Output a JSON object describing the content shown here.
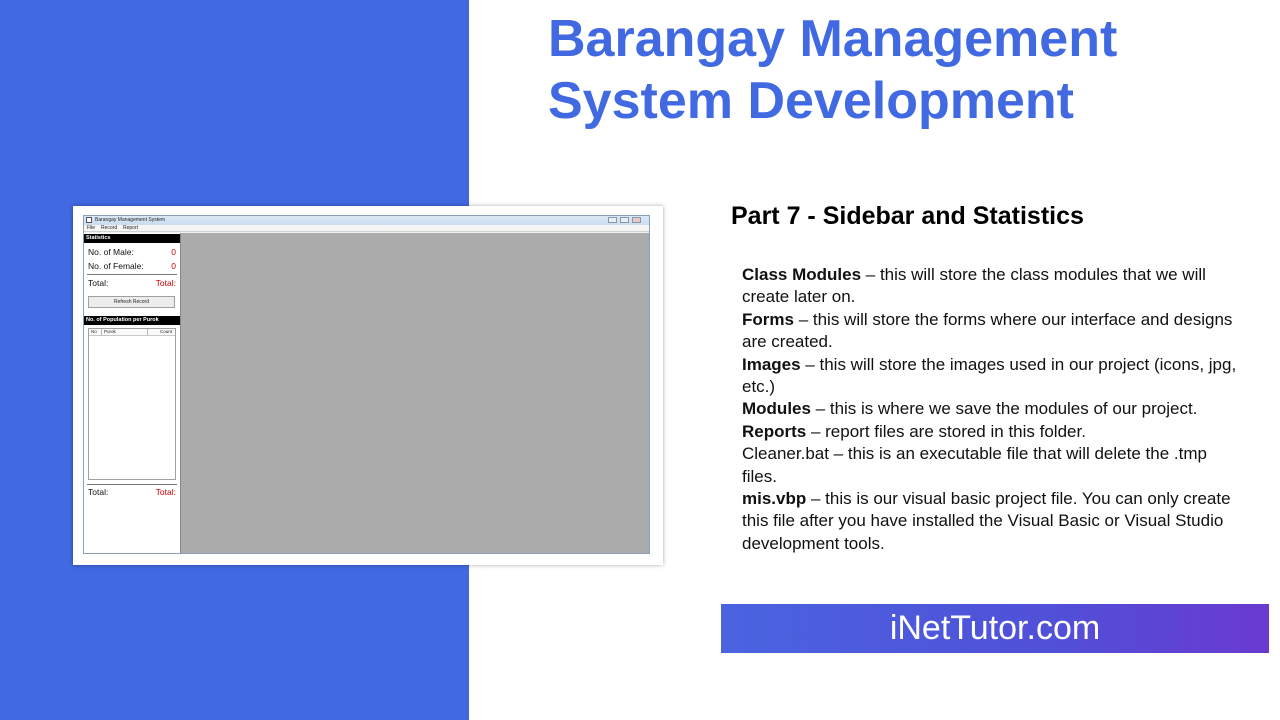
{
  "slide": {
    "title_line1": "Barangay Management",
    "title_line2": "System Development",
    "subtitle": "Part 7 - Sidebar and Statistics",
    "banner": "iNetTutor.com",
    "colors": {
      "accent": "#4169e1",
      "value_red": "#d00000"
    }
  },
  "descriptions": [
    {
      "term": "Class Modules",
      "text": " – this will store the class modules that we will create later on."
    },
    {
      "term": "Forms",
      "text": " – this will store the forms where our interface and designs are created."
    },
    {
      "term": "Images",
      "text": " – this will store the images used in our project (icons, jpg, etc.)"
    },
    {
      "term": "Modules",
      "text": " – this is where we save the modules of our project."
    },
    {
      "term": "Reports",
      "text": " – report files are stored in this folder."
    },
    {
      "term": "",
      "text": "Cleaner.bat – this is an executable file that will delete the .tmp files."
    },
    {
      "term": "mis.vbp",
      "text": " – this is our visual basic project file. You can only create this file after you have installed the Visual Basic or Visual Studio development tools."
    }
  ],
  "app": {
    "window_title": "Barangay Management System",
    "menu": [
      "File",
      "Record",
      "Report"
    ],
    "statistics": {
      "header": "Statistics",
      "male_label": "No. of Male:",
      "male_value": "0",
      "female_label": "No. of Female:",
      "female_value": "0",
      "total_label": "Total:",
      "total_value": "Total:",
      "refresh_button": "Refresh Record"
    },
    "population": {
      "header": "No. of Population per Purok",
      "columns": [
        "No",
        "Purok",
        "Count"
      ],
      "total_label": "Total:",
      "total_value": "Total:"
    }
  }
}
